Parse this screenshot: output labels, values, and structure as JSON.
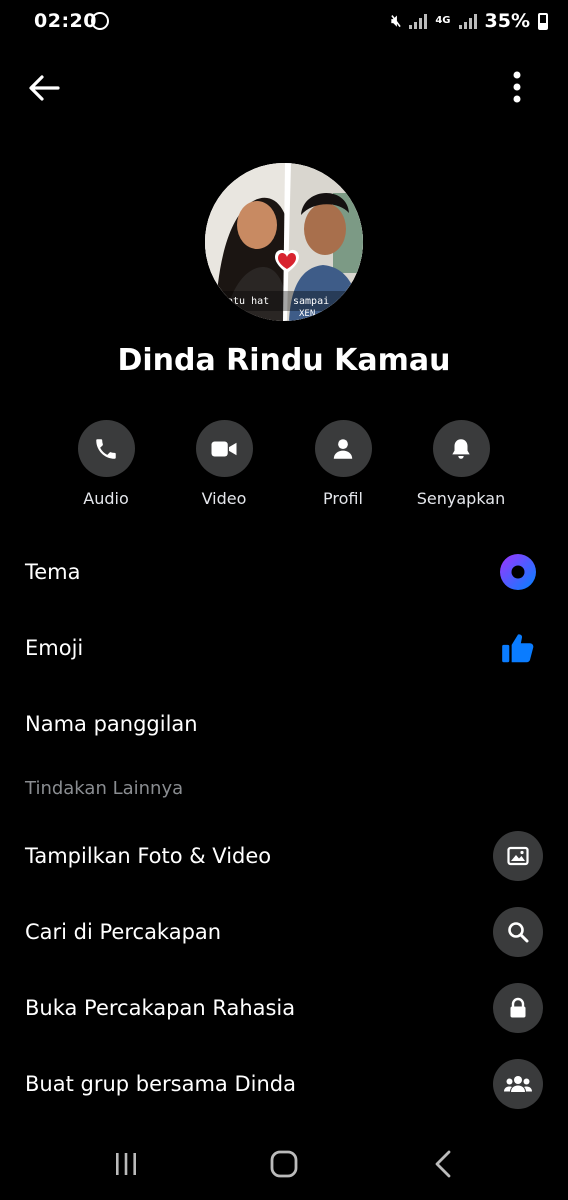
{
  "status_bar": {
    "time": "02:20",
    "network": "4G",
    "battery": "35%"
  },
  "contact": {
    "name": "Dinda Rindu Kamau",
    "avatar_caption_left": "atu hat",
    "avatar_caption_right": "sampai",
    "avatar_caption_right2": "XEN"
  },
  "actions": [
    {
      "label": "Audio"
    },
    {
      "label": "Video"
    },
    {
      "label": "Profil"
    },
    {
      "label": "Senyapkan"
    }
  ],
  "settings": {
    "theme_label": "Tema",
    "emoji_label": "Emoji",
    "nickname_label": "Nama panggilan",
    "section_header": "Tindakan Lainnya",
    "media_label": "Tampilkan Foto & Video",
    "search_label": "Cari di Percakapan",
    "secret_label": "Buka Percakapan Rahasia",
    "group_label": "Buat grup bersama Dinda"
  },
  "colors": {
    "theme_gradient_start": "#a033ff",
    "theme_gradient_end": "#0084ff",
    "like_blue": "#0a7cff",
    "button_bg": "#3a3b3c"
  },
  "icons": [
    "back-arrow-icon",
    "more-vertical-icon",
    "phone-icon",
    "video-camera-icon",
    "person-icon",
    "bell-icon",
    "thumbs-up-icon",
    "image-icon",
    "search-icon",
    "lock-icon",
    "group-icon"
  ]
}
